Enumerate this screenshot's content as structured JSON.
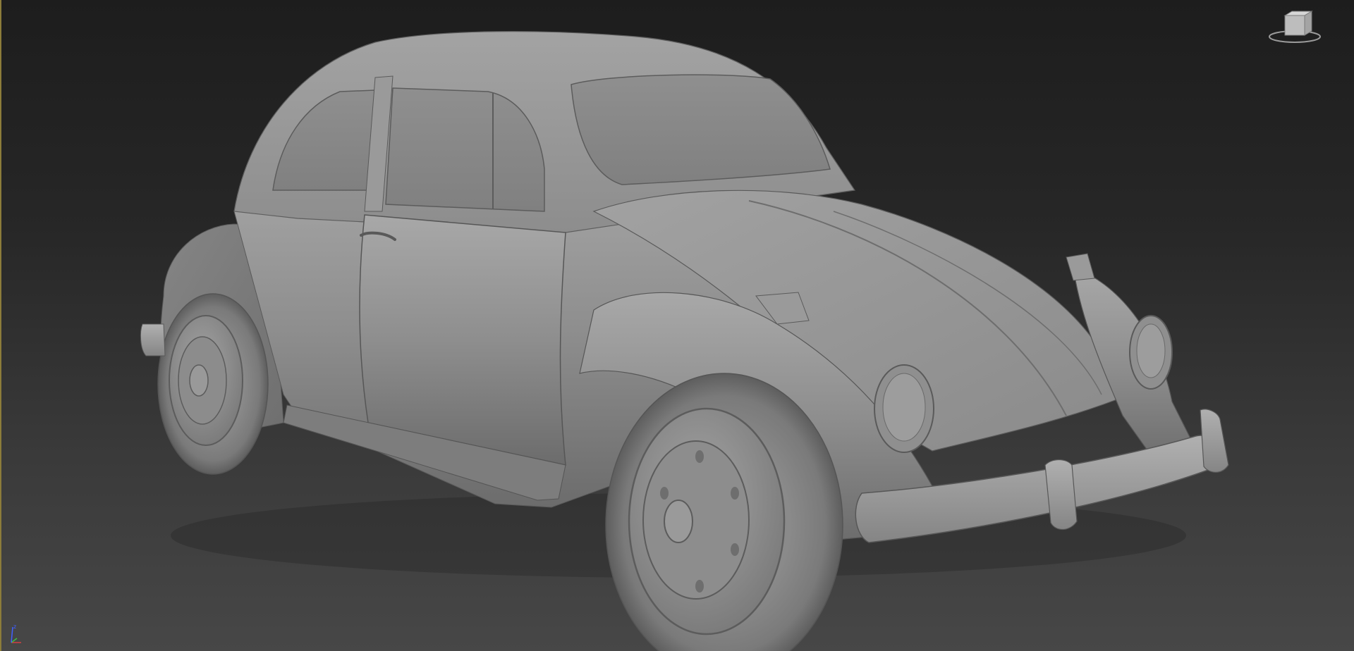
{
  "viewport": {
    "model_name": "",
    "shading": "shaded"
  },
  "viewcube": {
    "face_label": "",
    "icon": "viewcube-icon"
  },
  "axis_gizmo": {
    "icon": "axis-tripod-icon",
    "x_label": "x",
    "y_label": "y",
    "z_label": "z"
  },
  "colors": {
    "background_top": "#1d1d1d",
    "background_bottom": "#474747",
    "model_base": "#8a8a8a",
    "active_border": "#8c7c3a"
  }
}
